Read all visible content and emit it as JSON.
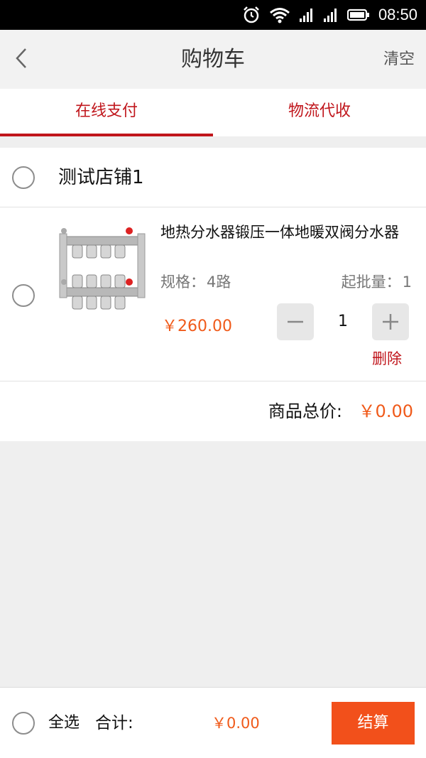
{
  "status_bar": {
    "time": "08:50"
  },
  "header": {
    "title": "购物车",
    "clear_label": "清空"
  },
  "tabs": [
    {
      "label": "在线支付",
      "active": true
    },
    {
      "label": "物流代收",
      "active": false
    }
  ],
  "store": {
    "name": "测试店铺1"
  },
  "product": {
    "title": "地热分水器锻压一体地暖双阀分水器",
    "spec_label": "规格：",
    "spec_value": "4路",
    "moq_label": "起批量：",
    "moq_value": "1",
    "price": "￥260.00",
    "quantity": "1",
    "delete_label": "删除"
  },
  "subtotal": {
    "label": "商品总价:",
    "value": "￥0.00"
  },
  "footer": {
    "select_all_label": "全选",
    "total_label": "合计:",
    "total_value": "￥0.00",
    "checkout_label": "结算"
  },
  "colors": {
    "accent_red": "#c0161c",
    "price_orange": "#f05a1a",
    "checkout_orange": "#f2501b"
  }
}
